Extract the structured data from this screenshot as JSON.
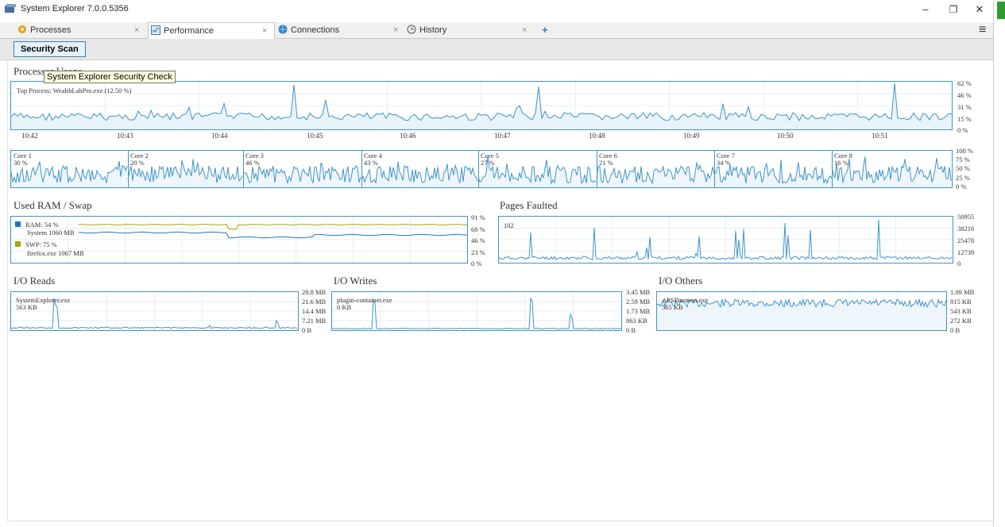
{
  "window": {
    "title": "System Explorer 7.0.0.5356",
    "minimize": "–",
    "restore": "❐",
    "close": "✕"
  },
  "tabs": [
    {
      "label": "Processes",
      "icon": "processes-icon",
      "close": "×"
    },
    {
      "label": "Performance",
      "icon": "performance-icon",
      "close": "×",
      "active": true
    },
    {
      "label": "Connections",
      "icon": "globe-icon",
      "close": "×"
    },
    {
      "label": "History",
      "icon": "clock-icon",
      "close": "×"
    }
  ],
  "add_tab": "+",
  "menu_icon": "≡",
  "toolbar": {
    "scan_label": "Security Scan"
  },
  "tooltip": "System Explorer Security Check",
  "processor": {
    "title": "Processor Usage",
    "top_process": "Top Process: WealthLabPro.exe (12.50 %)",
    "axis": [
      "62 %",
      "46 %",
      "31 %",
      "15 %",
      "0 %"
    ],
    "times": [
      "10:42",
      "10:43",
      "10:44",
      "10:45",
      "10:46",
      "10:47",
      "10:48",
      "10:49",
      "10:50",
      "10:51"
    ]
  },
  "cores": {
    "items": [
      {
        "name": "Core 1",
        "value": "30 %"
      },
      {
        "name": "Core 2",
        "value": "20 %"
      },
      {
        "name": "Core 3",
        "value": "46 %"
      },
      {
        "name": "Core 4",
        "value": "43 %"
      },
      {
        "name": "Core 5",
        "value": "27 %"
      },
      {
        "name": "Core 6",
        "value": "21 %"
      },
      {
        "name": "Core 7",
        "value": "34 %"
      },
      {
        "name": "Core 8",
        "value": "16 %"
      }
    ],
    "axis": [
      "100 %",
      "75 %",
      "50 %",
      "25 %",
      "0 %"
    ]
  },
  "ram": {
    "title": "Used RAM / Swap",
    "ram_label": "RAM: 54 %",
    "ram_sub": "System 1060 MB",
    "swap_label": "SWP: 75 %",
    "swap_sub": "firefox.exe 1067 MB",
    "ram_color": "#1e78b4",
    "swap_color": "#a8a800",
    "axis": [
      "91 %",
      "68 %",
      "46 %",
      "23 %",
      "0 %"
    ]
  },
  "pages": {
    "title": "Pages Faulted",
    "current": "102",
    "axis": [
      "50955",
      "38216",
      "25478",
      "12739",
      "0"
    ]
  },
  "io_reads": {
    "title": "I/O Reads",
    "process": "SystemExplorer.exe",
    "value": "563 KB",
    "axis": [
      "28.8 MB",
      "21.6 MB",
      "14.4 MB",
      "7.21 MB",
      "0 B"
    ]
  },
  "io_writes": {
    "title": "I/O Writes",
    "process": "plugin-container.exe",
    "value": "0 KB",
    "axis": [
      "3.45 MB",
      "2.59 MB",
      "1.73 MB",
      "863 KB",
      "0 B"
    ]
  },
  "io_others": {
    "title": "I/O Others",
    "process": "APSDaemon.exe",
    "value": "565 KB",
    "axis": [
      "1.09 MB",
      "815 KB",
      "543 KB",
      "272 KB",
      "0 B"
    ]
  },
  "accent_color": "#3f94c8"
}
